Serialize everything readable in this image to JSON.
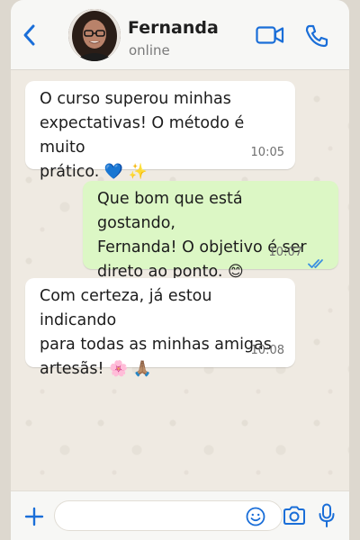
{
  "header": {
    "contact_name": "Fernanda",
    "status": "online",
    "icons": {
      "back": "chevron-left-icon",
      "video": "video-camera-icon",
      "call": "phone-icon"
    },
    "accent_color": "#1a6ed8"
  },
  "messages": [
    {
      "direction": "incoming",
      "text_line1": "O curso superou minhas",
      "text_line2": "expectativas! O método é muito",
      "text_line3": "prático.",
      "emojis": "💙 ✨",
      "time": "10:05"
    },
    {
      "direction": "outgoing",
      "text_line1": "Que bom que está gostando,",
      "text_line2": "Fernanda! O objetivo é ser",
      "text_line3": "direto ao ponto.",
      "emojis": "😊",
      "time": "10:07",
      "read": true
    },
    {
      "direction": "incoming",
      "text_line1": "Com certeza, já estou indicando",
      "text_line2": "para todas as minhas amigas",
      "text_line3": "artesãs!",
      "emojis": "🌸 🙏🏽",
      "time": "10:08"
    }
  ],
  "composer": {
    "input_value": "",
    "icons": {
      "attach": "plus-icon",
      "emoji": "smiley-icon",
      "camera": "camera-icon",
      "mic": "microphone-icon"
    }
  }
}
